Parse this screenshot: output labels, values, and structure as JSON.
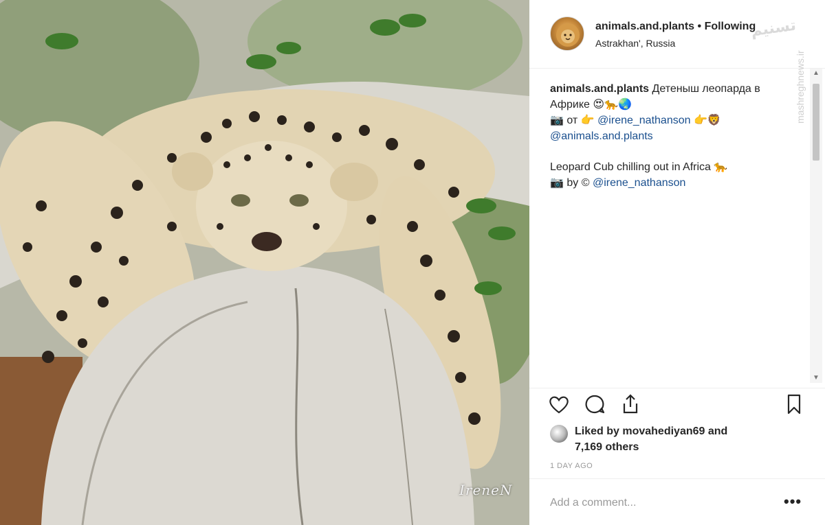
{
  "photo": {
    "alt": "Leopard cub lying on a white tree trunk",
    "credit": "IreneN"
  },
  "header": {
    "username": "animals.and.plants",
    "separator": "•",
    "follow_status": "Following",
    "location": "Astrakhan', Russia",
    "watermark": "تسنیم"
  },
  "caption": {
    "username": "animals.and.plants",
    "line1_text": "Детеныш леопарда в",
    "line2_text": "Африке 😍🐆🌏",
    "line3_prefix": "📷 от 👉",
    "line3_handle": "@irene_nathanson",
    "line3_suffix": "👉🦁",
    "line4_handle": "@animals.and.plants",
    "english_line": "Leopard Cub chilling out in Africa 🐆",
    "english_credit_prefix": "📷 by ©",
    "english_credit_handle": "@irene_nathanson"
  },
  "side_watermark": "mashreghnews.ir",
  "actions": {
    "like": "heart-icon",
    "comment": "comment-icon",
    "share": "share-icon",
    "save": "bookmark-icon"
  },
  "likes": {
    "prefix": "Liked by",
    "user": "movahediyan69",
    "suffix": "and",
    "others": "7,169 others"
  },
  "timestamp": "1 DAY AGO",
  "comment_box": {
    "placeholder": "Add a comment...",
    "more": "•••"
  }
}
